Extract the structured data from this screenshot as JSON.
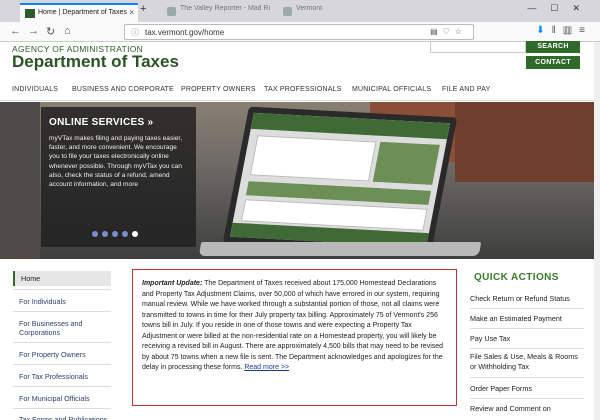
{
  "browser": {
    "active_tab": "Home | Department of Taxes",
    "bg_tab_1": "The Valley Reporter - Mad Ri",
    "bg_tab_2": "Vermont",
    "url": "tax.vermont.gov/home",
    "new_tab_symbol": "+",
    "close_symbol": "×"
  },
  "header": {
    "agency": "AGENCY OF ADMINISTRATION",
    "department": "Department of Taxes",
    "search_label": "SEARCH",
    "contact_label": "CONTACT"
  },
  "main_nav": [
    "INDIVIDUALS",
    "BUSINESS AND CORPORATE",
    "PROPERTY OWNERS",
    "TAX PROFESSIONALS",
    "MUNICIPAL OFFICIALS",
    "FILE AND PAY"
  ],
  "hero": {
    "title": "ONLINE SERVICES »",
    "text": "myVTax makes filing and paying taxes easier, faster, and more convenient. We encourage you to file your taxes electronically online whenever possible. Through myVTax you can also, check the status of a refund, amend account information, and more"
  },
  "left_nav": [
    "Home",
    "For Individuals",
    "For Businesses and Corporations",
    "For Property Owners",
    "For Tax Professionals",
    "For Municipal Officials",
    "Tax Forms and Publications"
  ],
  "notice": {
    "lead": "Important Update:",
    "body": " The Department of Taxes received about 175,000 Homestead Declarations and Property Tax Adjustment Claims, over 50,000 of which have errored in our system, requiring manual review. While we have worked through a substantial portion of those, not all claims were transmitted to towns in time for their July property tax billing. Approximately 75 of Vermont's 256 towns bill in July. If you reside in one of those towns and were expecting a Property Tax Adjustment or were billed at the non-residential rate on a Homestead property, you will likely be receiving a revised bill in August. There are approximately 4,500 bills that may need to be revised by about 75 towns when a new file is sent. The Department acknowledges and apologizes for the delay in processing these forms. ",
    "link": "Read more >>"
  },
  "quick_actions": {
    "title": "QUICK ACTIONS",
    "items": [
      "Check Return or Refund Status",
      "Make an Estimated Payment",
      "Pay Use Tax",
      "File Sales & Use, Meals & Rooms or Withholding Tax",
      "Order Paper Forms",
      "Review and Comment on"
    ]
  },
  "colors": {
    "brand_green": "#2b5424",
    "button_green": "#2e6b2a",
    "notice_border": "#c83232"
  }
}
